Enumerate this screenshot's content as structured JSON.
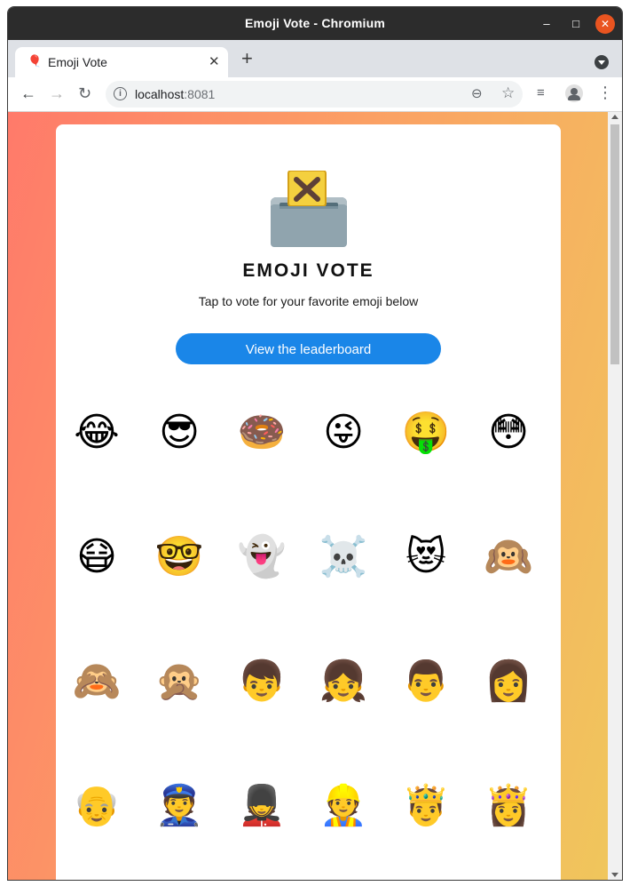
{
  "window": {
    "title": "Emoji Vote - Chromium",
    "controls": {
      "minimize": "–",
      "maximize": "□",
      "close": "✕"
    }
  },
  "tab": {
    "favicon": "🎈",
    "label": "Emoji Vote",
    "close": "✕"
  },
  "toolbar": {
    "url_host": "localhost",
    "url_port": ":8081",
    "back": "←",
    "forward": "→",
    "reload": "↻",
    "zoom": "⊖",
    "bookmark": "☆",
    "media": "≡",
    "menu": "⋮"
  },
  "page": {
    "logo_icon": "ballot-box-icon",
    "heading": "EMOJI VOTE",
    "subtitle": "Tap to vote for your favorite emoji below",
    "leaderboard_button": "View the leaderboard"
  },
  "emojis": [
    "😂",
    "😎",
    "🍩",
    "😜",
    "🤑",
    "😳",
    "😷",
    "🤓",
    "👻",
    "☠️",
    "😻",
    "🙉",
    "🙈",
    "🙊",
    "👦",
    "👧",
    "👨",
    "👩",
    "👴",
    "👮",
    "💂",
    "👷",
    "🤴",
    "👸"
  ]
}
